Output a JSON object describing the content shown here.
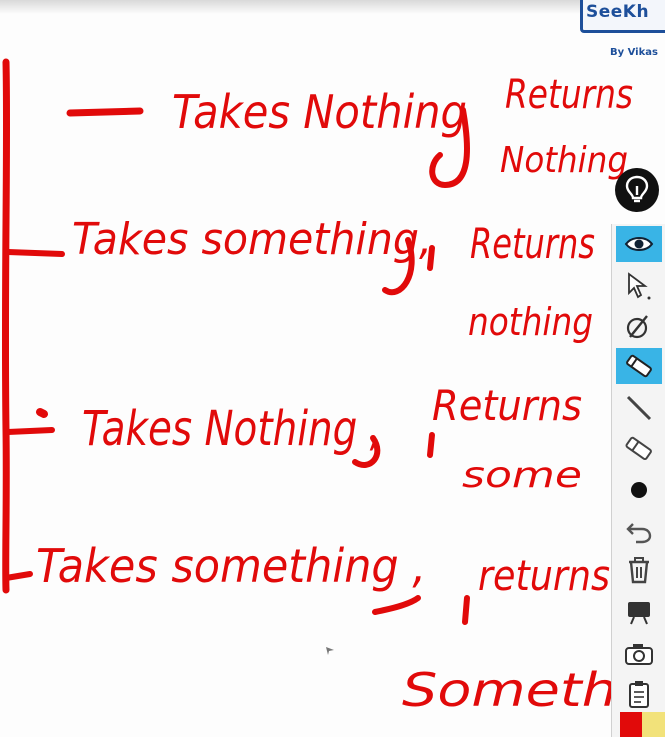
{
  "logo": {
    "text": "SeeKh",
    "subtitle": "By Vikas"
  },
  "board": {
    "lines": [
      {
        "takes": "Takes Nothing",
        "returns": "Returns",
        "returns2": "Nothing"
      },
      {
        "takes": "Takes something,",
        "returns": "Returns",
        "returns2": "nothing"
      },
      {
        "takes": "Takes Nothing ,",
        "returns": "Returns",
        "returns2": "some"
      },
      {
        "takes": "Takes something ,",
        "returns": "returns",
        "returns2": "Someth"
      }
    ]
  },
  "toolbar": {
    "tools": [
      {
        "name": "pin-icon"
      },
      {
        "name": "eye-icon",
        "active": true
      },
      {
        "name": "pointer-icon"
      },
      {
        "name": "laser-icon"
      },
      {
        "name": "pen-icon",
        "active": true
      },
      {
        "name": "line-icon"
      },
      {
        "name": "eraser-icon"
      },
      {
        "name": "dot-size-icon"
      },
      {
        "name": "undo-icon"
      },
      {
        "name": "trash-icon"
      },
      {
        "name": "board-icon"
      },
      {
        "name": "camera-icon"
      },
      {
        "name": "clipboard-icon"
      }
    ],
    "colors": {
      "red": "#e10a0a",
      "yellow": "#f2e27a",
      "accent": "#39b4e6"
    }
  }
}
